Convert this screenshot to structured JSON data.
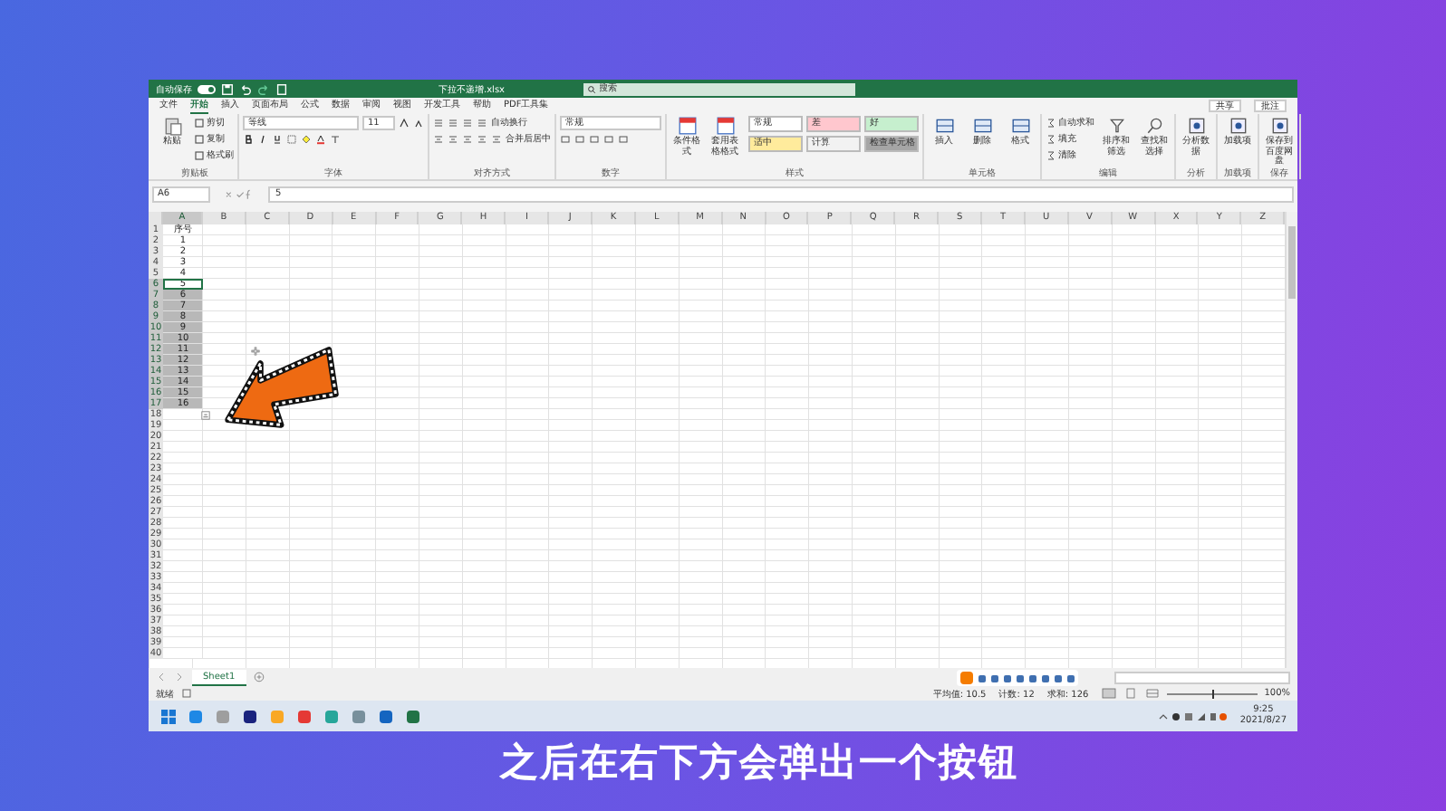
{
  "titlebar": {
    "autosave": {
      "label": "自动保存",
      "on": true
    },
    "title": "下拉不递增.xlsx",
    "search": {
      "placeholder": "搜索"
    }
  },
  "menu": [
    {
      "label": "文件",
      "selected": false
    },
    {
      "label": "开始",
      "selected": true
    },
    {
      "label": "插入",
      "selected": false
    },
    {
      "label": "页面布局",
      "selected": false
    },
    {
      "label": "公式",
      "selected": false
    },
    {
      "label": "数据",
      "selected": false
    },
    {
      "label": "审阅",
      "selected": false
    },
    {
      "label": "视图",
      "selected": false
    },
    {
      "label": "开发工具",
      "selected": false
    },
    {
      "label": "帮助",
      "selected": false
    },
    {
      "label": "PDF工具集",
      "selected": false
    }
  ],
  "menu_actions": [
    "共享",
    "批注"
  ],
  "ribbon": {
    "clipboard": {
      "title": "剪贴板",
      "paste": "粘贴",
      "items": [
        "剪切",
        "复制",
        "格式刷"
      ]
    },
    "font": {
      "title": "字体",
      "name": "等线",
      "size": "11"
    },
    "align": {
      "title": "对齐方式",
      "wrap": "自动换行",
      "merge": "合并后居中"
    },
    "number": {
      "title": "数字",
      "format": "常规"
    },
    "styles": {
      "title": "样式",
      "buttons": [
        "条件格式",
        "套用表格格式"
      ],
      "cells": [
        {
          "label": "常规",
          "color": "#ffffff"
        },
        {
          "label": "差",
          "color": "#ffc7ce"
        },
        {
          "label": "好",
          "color": "#c6efce"
        },
        {
          "label": "适中",
          "color": "#ffeb9c"
        },
        {
          "label": "计算",
          "color": "#f2f2f2"
        },
        {
          "label": "检查单元格",
          "color": "#a5a5a5"
        }
      ]
    },
    "cells": {
      "title": "单元格",
      "items": [
        "插入",
        "删除",
        "格式"
      ]
    },
    "editing": {
      "title": "编辑",
      "small": [
        "自动求和",
        "填充",
        "清除"
      ],
      "big": [
        "排序和筛选",
        "查找和选择"
      ]
    },
    "extra": [
      {
        "title": "分析",
        "item": "分析数据"
      },
      {
        "title": "加载项",
        "item": "加载项"
      },
      {
        "title": "保存",
        "item": "保存到百度网盘"
      }
    ]
  },
  "formula_bar": {
    "name_box": "A6",
    "value": "5"
  },
  "columns": [
    "A",
    "B",
    "C",
    "D",
    "E",
    "F",
    "G",
    "H",
    "I",
    "J",
    "K",
    "L",
    "M",
    "N",
    "O",
    "P",
    "Q",
    "R",
    "S",
    "T",
    "U",
    "V",
    "W",
    "X",
    "Y",
    "Z"
  ],
  "rows": [
    {
      "number": "1",
      "a": "序号",
      "selected": false,
      "active": false
    },
    {
      "number": "2",
      "a": "1",
      "selected": false,
      "active": false
    },
    {
      "number": "3",
      "a": "2",
      "selected": false,
      "active": false
    },
    {
      "number": "4",
      "a": "3",
      "selected": false,
      "active": false
    },
    {
      "number": "5",
      "a": "4",
      "selected": false,
      "active": false
    },
    {
      "number": "6",
      "a": "5",
      "selected": true,
      "active": true
    },
    {
      "number": "7",
      "a": "6",
      "selected": true,
      "active": false
    },
    {
      "number": "8",
      "a": "7",
      "selected": true,
      "active": false
    },
    {
      "number": "9",
      "a": "8",
      "selected": true,
      "active": false
    },
    {
      "number": "10",
      "a": "9",
      "selected": true,
      "active": false
    },
    {
      "number": "11",
      "a": "10",
      "selected": true,
      "active": false
    },
    {
      "number": "12",
      "a": "11",
      "selected": true,
      "active": false
    },
    {
      "number": "13",
      "a": "12",
      "selected": true,
      "active": false
    },
    {
      "number": "14",
      "a": "13",
      "selected": true,
      "active": false
    },
    {
      "number": "15",
      "a": "14",
      "selected": true,
      "active": false
    },
    {
      "number": "16",
      "a": "15",
      "selected": true,
      "active": false
    },
    {
      "number": "17",
      "a": "16",
      "selected": true,
      "active": false
    },
    {
      "number": "18",
      "selected": false,
      "active": false
    },
    {
      "number": "19",
      "selected": false,
      "active": false
    },
    {
      "number": "20",
      "selected": false,
      "active": false
    },
    {
      "number": "21",
      "selected": false,
      "active": false
    },
    {
      "number": "22",
      "selected": false,
      "active": false
    },
    {
      "number": "23",
      "selected": false,
      "active": false
    },
    {
      "number": "24",
      "selected": false,
      "active": false
    },
    {
      "number": "25",
      "selected": false,
      "active": false
    },
    {
      "number": "26",
      "selected": false,
      "active": false
    },
    {
      "number": "27",
      "selected": false,
      "active": false
    },
    {
      "number": "28",
      "selected": false,
      "active": false
    },
    {
      "number": "29",
      "selected": false,
      "active": false
    },
    {
      "number": "30",
      "selected": false,
      "active": false
    },
    {
      "number": "31",
      "selected": false,
      "active": false
    },
    {
      "number": "32",
      "selected": false,
      "active": false
    },
    {
      "number": "33",
      "selected": false,
      "active": false
    },
    {
      "number": "34",
      "selected": false,
      "active": false
    },
    {
      "number": "35",
      "selected": false,
      "active": false
    },
    {
      "number": "36",
      "selected": false,
      "active": false
    },
    {
      "number": "37",
      "selected": false,
      "active": false
    },
    {
      "number": "38",
      "selected": false,
      "active": false
    },
    {
      "number": "39",
      "selected": false,
      "active": false
    },
    {
      "number": "40",
      "selected": false,
      "active": false
    }
  ],
  "sheets": [
    {
      "label": "Sheet1",
      "selected": true
    }
  ],
  "status": {
    "text": "就绪",
    "stats": [
      "平均值: 10.5",
      "计数: 12",
      "求和: 126"
    ],
    "zoom": "100%",
    "zoom_slider": {
      "level": 0.5
    }
  },
  "taskbar": {
    "time": "9:25",
    "date": "2021/8/27"
  },
  "subtitle": "之后在右下方会弹出一个按钮"
}
